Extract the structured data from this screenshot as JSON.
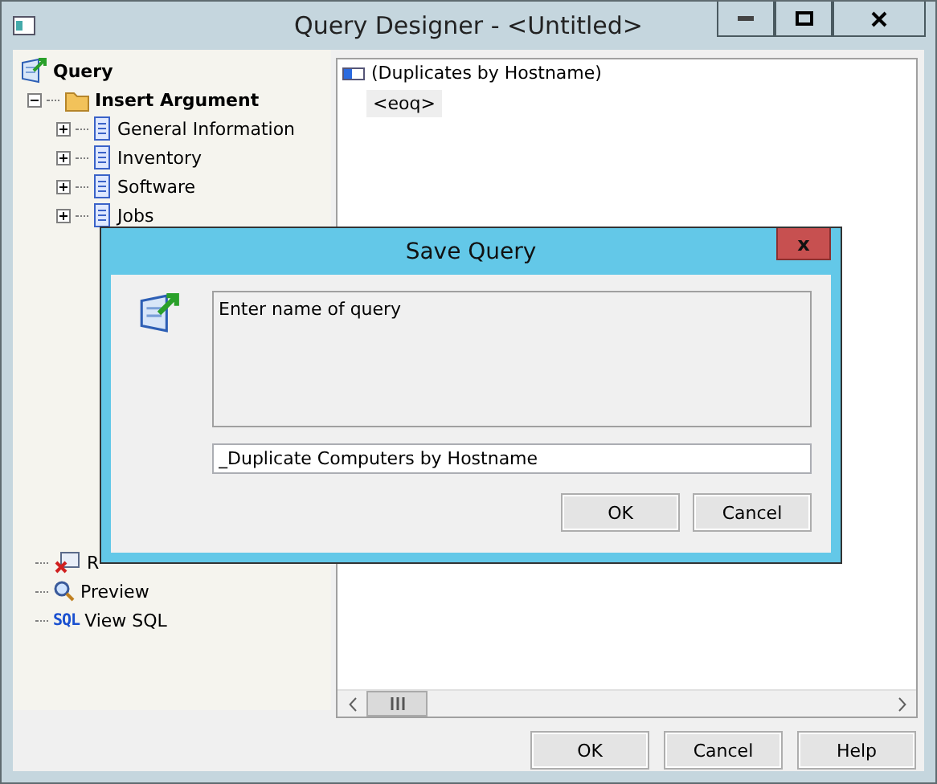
{
  "window": {
    "title": "Query Designer - <Untitled>"
  },
  "tree": {
    "root": {
      "label": "Query",
      "children": [
        {
          "label": "Insert Argument",
          "expanded": true,
          "children": [
            {
              "label": "General Information",
              "expanded": false
            },
            {
              "label": "Inventory",
              "expanded": false
            },
            {
              "label": "Software",
              "expanded": false
            },
            {
              "label": "Jobs",
              "expanded": false
            }
          ]
        }
      ]
    },
    "actions": [
      {
        "label": "R",
        "kind": "remove"
      },
      {
        "label": "Preview",
        "kind": "preview"
      },
      {
        "label": "View SQL",
        "kind": "sql",
        "icon_text": "SQL"
      }
    ]
  },
  "query_pane": {
    "title": "(Duplicates by Hostname)",
    "end_token": "<eoq>"
  },
  "buttons": [
    "OK",
    "Cancel",
    "Help"
  ],
  "dialog": {
    "title": "Save Query",
    "close": "x",
    "message": "Enter name of query",
    "value": "_Duplicate Computers by Hostname",
    "buttons": [
      "OK",
      "Cancel"
    ]
  }
}
